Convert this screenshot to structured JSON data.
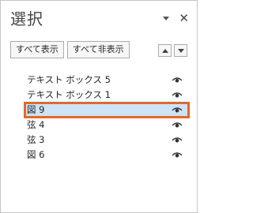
{
  "pane": {
    "title": "選択",
    "show_all_label": "すべて表示",
    "hide_all_label": "すべて非表示"
  },
  "icons": {
    "dropdown": "chevron-down-icon",
    "close": "close-icon",
    "bring_forward": "arrow-up-icon",
    "send_backward": "arrow-down-icon",
    "visibility": "eye-icon"
  },
  "items": [
    {
      "label": "テキスト ボックス 5",
      "selected": false
    },
    {
      "label": "テキスト ボックス 1",
      "selected": false
    },
    {
      "label": "図 9",
      "selected": true
    },
    {
      "label": "弦 4",
      "selected": false
    },
    {
      "label": "弦 3",
      "selected": false
    },
    {
      "label": "図 6",
      "selected": false
    }
  ],
  "colors": {
    "selection_fill": "#cde3f7",
    "selection_highlight": "#e1692d"
  }
}
